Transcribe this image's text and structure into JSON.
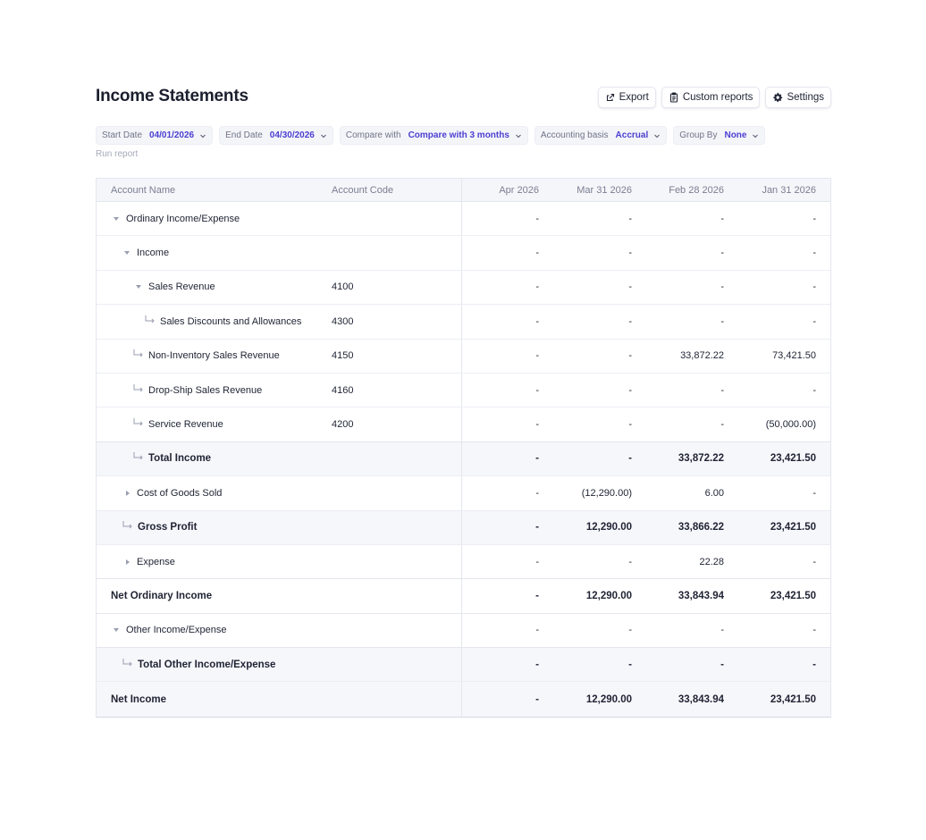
{
  "page": {
    "title": "Income Statements"
  },
  "toolbar": {
    "export_label": "Export",
    "custom_reports_label": "Custom reports",
    "settings_label": "Settings",
    "export_icon": "export-icon",
    "custom_reports_icon": "clipboard-icon",
    "settings_icon": "gear-icon"
  },
  "filters": [
    {
      "label": "Start Date",
      "value": "04/01/2026"
    },
    {
      "label": "End Date",
      "value": "04/30/2026"
    },
    {
      "label": "Compare with",
      "value": "Compare with 3 months"
    },
    {
      "label": "Accounting basis",
      "value": "Accrual"
    },
    {
      "label": "Group By",
      "value": "None"
    }
  ],
  "run_report_label": "Run report",
  "colors": {
    "accent": "#4b3fd1",
    "total_row_bg": "#f6f7fb",
    "header_bg": "#f5f6fa"
  },
  "table": {
    "headers": {
      "account_name": "Account Name",
      "account_code": "Account Code",
      "apr": "Apr 2026",
      "mar": "Mar 31 2026",
      "feb": "Feb 28 2026",
      "jan": "Jan 31 2026"
    },
    "rows": [
      {
        "name": "Ordinary Income/Expense",
        "code": "",
        "apr": "-",
        "mar": "-",
        "feb": "-",
        "jan": "-"
      },
      {
        "name": "Income",
        "code": "",
        "apr": "-",
        "mar": "-",
        "feb": "-",
        "jan": "-"
      },
      {
        "name": "Sales Revenue",
        "code": "4100",
        "apr": "-",
        "mar": "-",
        "feb": "-",
        "jan": "-"
      },
      {
        "name": "Sales Discounts and Allowances",
        "code": "4300",
        "apr": "-",
        "mar": "-",
        "feb": "-",
        "jan": "-"
      },
      {
        "name": "Non-Inventory Sales Revenue",
        "code": "4150",
        "apr": "-",
        "mar": "-",
        "feb": "33,872.22",
        "jan": "73,421.50"
      },
      {
        "name": "Drop-Ship Sales Revenue",
        "code": "4160",
        "apr": "-",
        "mar": "-",
        "feb": "-",
        "jan": "-"
      },
      {
        "name": "Service Revenue",
        "code": "4200",
        "apr": "-",
        "mar": "-",
        "feb": "-",
        "jan": "(50,000.00)"
      },
      {
        "name": "Total Income",
        "code": "",
        "apr": "-",
        "mar": "-",
        "feb": "33,872.22",
        "jan": "23,421.50"
      },
      {
        "name": "Cost of Goods Sold",
        "code": "",
        "apr": "-",
        "mar": "(12,290.00)",
        "feb": "6.00",
        "jan": "-"
      },
      {
        "name": "Gross Profit",
        "code": "",
        "apr": "-",
        "mar": "12,290.00",
        "feb": "33,866.22",
        "jan": "23,421.50"
      },
      {
        "name": "Expense",
        "code": "",
        "apr": "-",
        "mar": "-",
        "feb": "22.28",
        "jan": "-"
      },
      {
        "name": "Net Ordinary Income",
        "code": "",
        "apr": "-",
        "mar": "12,290.00",
        "feb": "33,843.94",
        "jan": "23,421.50"
      },
      {
        "name": "Other Income/Expense",
        "code": "",
        "apr": "-",
        "mar": "-",
        "feb": "-",
        "jan": "-"
      },
      {
        "name": "Total Other Income/Expense",
        "code": "",
        "apr": "-",
        "mar": "-",
        "feb": "-",
        "jan": "-"
      },
      {
        "name": "Net Income",
        "code": "",
        "apr": "-",
        "mar": "12,290.00",
        "feb": "33,843.94",
        "jan": "23,421.50"
      }
    ]
  }
}
